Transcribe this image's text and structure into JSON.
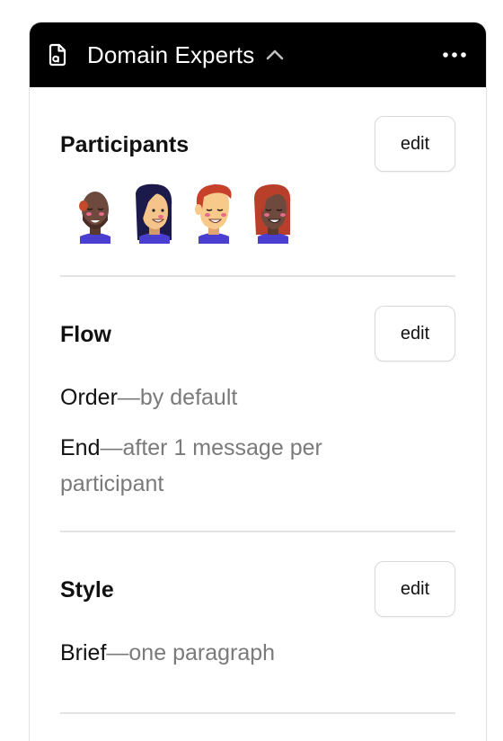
{
  "header": {
    "title": "Domain Experts",
    "icons": {
      "doc": "document-icon",
      "chevron": "chevron-up-icon",
      "more": "more-horizontal-icon"
    }
  },
  "participants": {
    "title": "Participants",
    "edit_label": "edit",
    "avatars": [
      "avatar-1",
      "avatar-2",
      "avatar-3",
      "avatar-4"
    ]
  },
  "flow": {
    "title": "Flow",
    "edit_label": "edit",
    "settings": [
      {
        "key": "Order",
        "value": "—by default"
      },
      {
        "key": "End",
        "value": "—after 1 message per participant"
      }
    ]
  },
  "style": {
    "title": "Style",
    "edit_label": "edit",
    "settings": [
      {
        "key": "Brief",
        "value": "—one paragraph"
      }
    ]
  },
  "colors": {
    "header_bg": "#000000",
    "muted_text": "#7a7a7a",
    "divider": "#e3e3e3"
  }
}
